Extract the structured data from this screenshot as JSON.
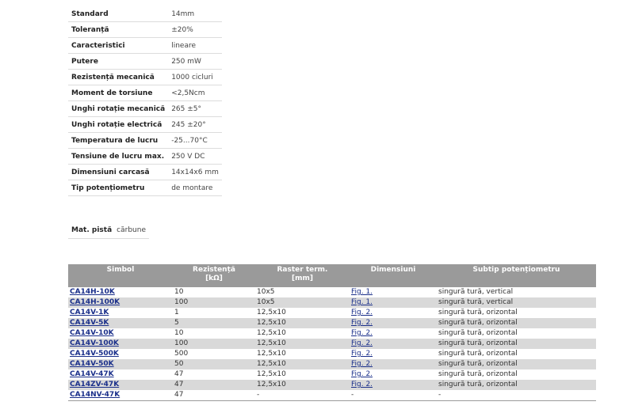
{
  "specs": [
    {
      "label": "Standard",
      "value": "14mm"
    },
    {
      "label": "Toleranță",
      "value": "±20%"
    },
    {
      "label": "Caracteristici",
      "value": "lineare"
    },
    {
      "label": "Putere",
      "value": "250 mW"
    },
    {
      "label": "Rezistență mecanică",
      "value": "1000 cicluri"
    },
    {
      "label": "Moment de torsiune",
      "value": "<2,5Ncm"
    },
    {
      "label": "Unghi rotație mecanică",
      "value": "265 ±5°"
    },
    {
      "label": "Unghi rotație electrică",
      "value": "245 ±20°"
    },
    {
      "label": "Temperatura de lucru",
      "value": "-25...70°C"
    },
    {
      "label": "Tensiune de lucru max.",
      "value": "250 V DC"
    },
    {
      "label": "Dimensiuni carcasă",
      "value": "14x14x6 mm"
    },
    {
      "label": "Tip potențiometru",
      "value": "de montare"
    }
  ],
  "mat_pista": {
    "label": "Mat. pistă",
    "value": "cărbune"
  },
  "products": {
    "headers": {
      "simbol": "Simbol",
      "rezistenta": "Rezistență",
      "rezistenta_unit": "[kΩ]",
      "raster": "Raster term.",
      "raster_unit": "[mm]",
      "dimensiuni": "Dimensiuni",
      "subtip": "Subtip potențiometru"
    },
    "rows": [
      {
        "symbol": "CA14H-10K",
        "resistance": "10",
        "raster": "10x5",
        "dimension": "Fig. 1.",
        "subtype": "singură tură, vertical"
      },
      {
        "symbol": "CA14H-100K",
        "resistance": "100",
        "raster": "10x5",
        "dimension": "Fig. 1.",
        "subtype": "singură tură, vertical"
      },
      {
        "symbol": "CA14V-1K",
        "resistance": "1",
        "raster": "12,5x10",
        "dimension": "Fig. 2.",
        "subtype": "singură tură, orizontal"
      },
      {
        "symbol": "CA14V-5K",
        "resistance": "5",
        "raster": "12,5x10",
        "dimension": "Fig. 2.",
        "subtype": "singură tură, orizontal"
      },
      {
        "symbol": "CA14V-10K",
        "resistance": "10",
        "raster": "12,5x10",
        "dimension": "Fig. 2.",
        "subtype": "singură tură, orizontal"
      },
      {
        "symbol": "CA14V-100K",
        "resistance": "100",
        "raster": "12,5x10",
        "dimension": "Fig. 2.",
        "subtype": "singură tură, orizontal"
      },
      {
        "symbol": "CA14V-500K",
        "resistance": "500",
        "raster": "12,5x10",
        "dimension": "Fig. 2.",
        "subtype": "singură tură, orizontal"
      },
      {
        "symbol": "CA14V-50K",
        "resistance": "50",
        "raster": "12,5x10",
        "dimension": "Fig. 2.",
        "subtype": "singură tură, orizontal"
      },
      {
        "symbol": "CA14V-47K",
        "resistance": "47",
        "raster": "12,5x10",
        "dimension": "Fig. 2.",
        "subtype": "singură tură, orizontal"
      },
      {
        "symbol": "CA14ZV-47K",
        "resistance": "47",
        "raster": "12,5x10",
        "dimension": "Fig. 2.",
        "subtype": "singură tură, orizontal"
      },
      {
        "symbol": "CA14NV-47K",
        "resistance": "47",
        "raster": "-",
        "dimension": "-",
        "subtype": "-"
      }
    ]
  },
  "colors": {
    "header_bg": "#9a9a9a",
    "alt_row_bg": "#d9d9d9",
    "link": "#1a2f8a"
  }
}
